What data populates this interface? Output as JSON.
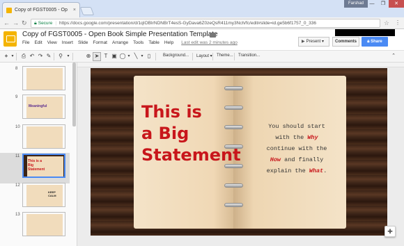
{
  "browser": {
    "tab_title": "Copy of FGST0005 - Op",
    "tab_close": "×",
    "profile_name": "Farshad",
    "window_buttons": [
      "—",
      "❐",
      "✕"
    ],
    "secure_label": "Secure",
    "url": "https://docs.google.com/presentation/d/1qIOBIrNDNBrT4esS-GyDava6Z0zeQsR411my3Nch/fc/edit#slide=id.ge5b6f1757_0_336"
  },
  "app": {
    "doc_title": "Copy of FGST0005 - Open Book Simple Presentation Template",
    "menu": [
      "File",
      "Edit",
      "View",
      "Insert",
      "Slide",
      "Format",
      "Arrange",
      "Tools",
      "Table",
      "Help"
    ],
    "last_edit": "Last edit was 2 minutes ago",
    "present_label": "Present",
    "comments_label": "Comments",
    "share_label": "Share",
    "share_icon": "lock-icon"
  },
  "toolbar": {
    "add_label": "+",
    "background_label": "Background...",
    "layout_label": "Layout",
    "theme_label": "Theme...",
    "transition_label": "Transition..."
  },
  "filmstrip": {
    "slides": [
      {
        "num": "8",
        "label": ""
      },
      {
        "num": "9",
        "label": "Meaningful"
      },
      {
        "num": "10",
        "label": ""
      },
      {
        "num": "11",
        "label": "This is a Big Statement"
      },
      {
        "num": "12",
        "label": "KEEP CALM"
      },
      {
        "num": "13",
        "label": ""
      }
    ],
    "active_index": 3
  },
  "slide": {
    "big_text": "This is\na Big\nStatement",
    "body": {
      "line1": "You should start",
      "line2_pre": "with the ",
      "why": "Why",
      "line3": "continue with the",
      "how": "How",
      "line4_post": " and finally",
      "line5_pre": "explain the ",
      "what": "What",
      "line5_post": "."
    },
    "accent_color": "#c8161b"
  },
  "colors": {
    "slides_brand": "#f4b400",
    "share_blue": "#4a8af4"
  }
}
